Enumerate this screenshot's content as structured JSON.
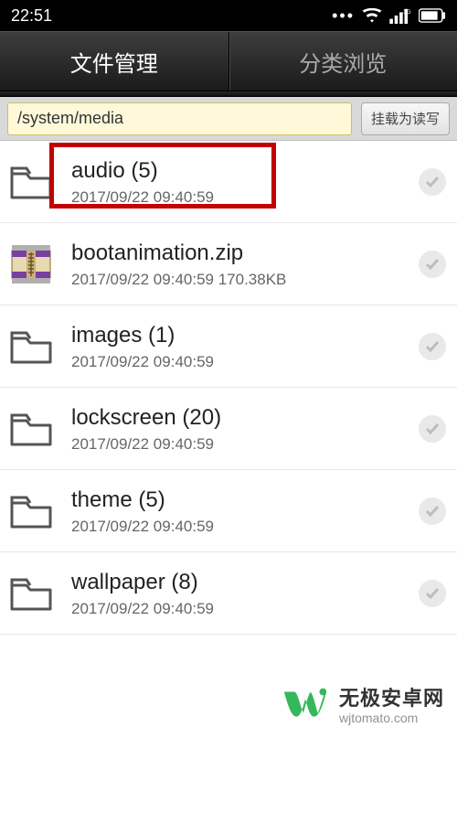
{
  "statusbar": {
    "time": "22:51",
    "network_label": "3G"
  },
  "tabs": {
    "file_mgmt": "文件管理",
    "category": "分类浏览"
  },
  "pathbar": {
    "path": "/system/media",
    "mount_btn": "挂载为读写"
  },
  "files": [
    {
      "title": "audio  (5)",
      "sub": "2017/09/22 09:40:59",
      "type": "folder",
      "highlight": true
    },
    {
      "title": "bootanimation.zip",
      "sub": "2017/09/22 09:40:59   170.38KB",
      "type": "zip"
    },
    {
      "title": "images  (1)",
      "sub": "2017/09/22 09:40:59",
      "type": "folder"
    },
    {
      "title": "lockscreen  (20)",
      "sub": "2017/09/22 09:40:59",
      "type": "folder"
    },
    {
      "title": "theme  (5)",
      "sub": "2017/09/22 09:40:59",
      "type": "folder"
    },
    {
      "title": "wallpaper  (8)",
      "sub": "2017/09/22 09:40:59",
      "type": "folder"
    }
  ],
  "watermark": {
    "title": "无极安卓网",
    "sub": "wjtomato.com"
  }
}
